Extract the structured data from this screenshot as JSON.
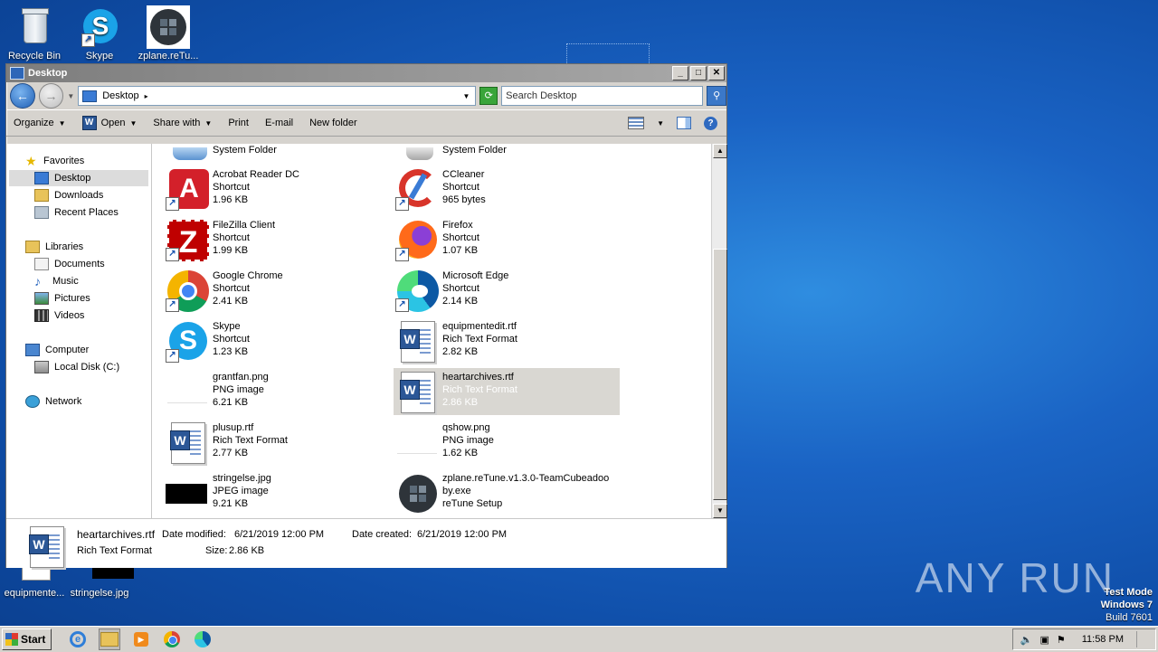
{
  "desktop": {
    "icons": [
      {
        "label": "Recycle Bin"
      },
      {
        "label": "Skype"
      },
      {
        "label": "zplane.reTu..."
      },
      {
        "label": "equipmente..."
      },
      {
        "label": "stringelse.jpg"
      }
    ],
    "watermark": "ANY RUN",
    "test_mode": {
      "line1": "Test Mode",
      "line2": "Windows 7",
      "line3": "Build 7601"
    }
  },
  "window": {
    "title": "Desktop",
    "address": "Desktop",
    "search_placeholder": "Search Desktop",
    "toolbar": {
      "organize": "Organize",
      "open": "Open",
      "share_with": "Share with",
      "print": "Print",
      "email": "E-mail",
      "new_folder": "New folder"
    },
    "nav": {
      "favorites": "Favorites",
      "desktop": "Desktop",
      "downloads": "Downloads",
      "recent_places": "Recent Places",
      "libraries": "Libraries",
      "documents": "Documents",
      "music": "Music",
      "pictures": "Pictures",
      "videos": "Videos",
      "computer": "Computer",
      "local_disk": "Local Disk (C:)",
      "network": "Network"
    },
    "partial_top": {
      "left": "System Folder",
      "right": "System Folder"
    },
    "files": [
      {
        "name": "Acrobat Reader DC",
        "type": "Shortcut",
        "size": "1.96 KB"
      },
      {
        "name": "CCleaner",
        "type": "Shortcut",
        "size": "965 bytes"
      },
      {
        "name": "FileZilla Client",
        "type": "Shortcut",
        "size": "1.99 KB"
      },
      {
        "name": "Firefox",
        "type": "Shortcut",
        "size": "1.07 KB"
      },
      {
        "name": "Google Chrome",
        "type": "Shortcut",
        "size": "2.41 KB"
      },
      {
        "name": "Microsoft Edge",
        "type": "Shortcut",
        "size": "2.14 KB"
      },
      {
        "name": "Skype",
        "type": "Shortcut",
        "size": "1.23 KB"
      },
      {
        "name": "equipmentedit.rtf",
        "type": "Rich Text Format",
        "size": "2.82 KB"
      },
      {
        "name": "grantfan.png",
        "type": "PNG image",
        "size": "6.21 KB"
      },
      {
        "name": "heartarchives.rtf",
        "type": "Rich Text Format",
        "size": "2.86 KB"
      },
      {
        "name": "plusup.rtf",
        "type": "Rich Text Format",
        "size": "2.77 KB"
      },
      {
        "name": "qshow.png",
        "type": "PNG image",
        "size": "1.62 KB"
      },
      {
        "name": "stringelse.jpg",
        "type": "JPEG image",
        "size": "9.21 KB"
      },
      {
        "name": "zplane.reTune.v1.3.0-TeamCubeadoo",
        "type": "by.exe",
        "size": "reTune Setup"
      }
    ],
    "details": {
      "name": "heartarchives.rtf",
      "modified_label": "Date modified:",
      "modified": "6/21/2019 12:00 PM",
      "created_label": "Date created:",
      "created": "6/21/2019 12:00 PM",
      "type": "Rich Text Format",
      "size_label": "Size:",
      "size": "2.86 KB"
    }
  },
  "taskbar": {
    "start": "Start",
    "clock": "11:58 PM"
  },
  "colors": {
    "selection": "#d9d7d2",
    "desktop_blue": "#1a63c4",
    "window_face": "#d6d3ce"
  }
}
